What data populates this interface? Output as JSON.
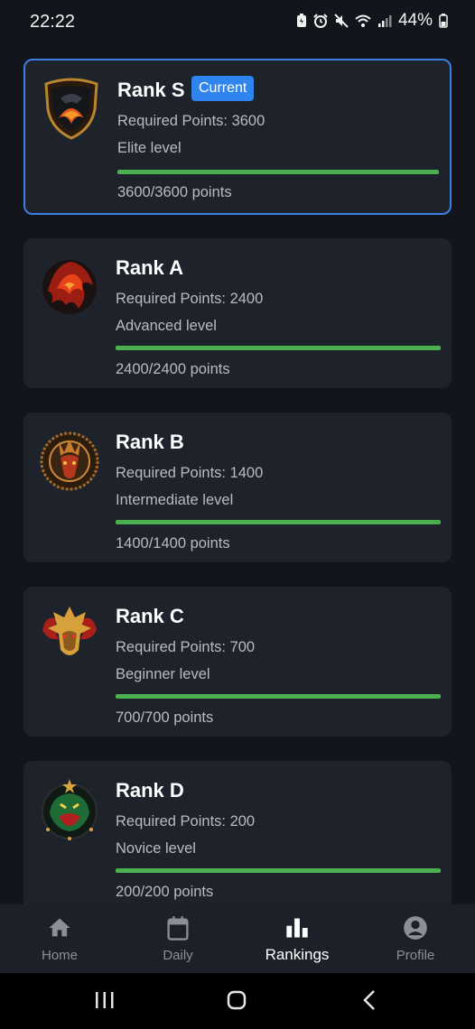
{
  "status": {
    "time": "22:22",
    "battery": "44%"
  },
  "colors": {
    "accent": "#2f84ee",
    "progress": "#4caf50",
    "card": "#1e222b",
    "background": "#12151c"
  },
  "ranks": [
    {
      "title": "Rank S",
      "badge_icon": "dragon-shield-badge",
      "current_label": "Current",
      "required": "Required Points: 3600",
      "level": "Elite level",
      "points": "3600/3600 points",
      "progress": 1.0
    },
    {
      "title": "Rank A",
      "badge_icon": "fire-dragon-badge",
      "required": "Required Points: 2400",
      "level": "Advanced level",
      "points": "2400/2400 points",
      "progress": 1.0
    },
    {
      "title": "Rank B",
      "badge_icon": "bronze-dragon-emblem",
      "required": "Required Points: 1400",
      "level": "Intermediate level",
      "points": "1400/1400 points",
      "progress": 1.0
    },
    {
      "title": "Rank C",
      "badge_icon": "golden-dragon-badge",
      "required": "Required Points: 700",
      "level": "Beginner level",
      "points": "700/700 points",
      "progress": 1.0
    },
    {
      "title": "Rank D",
      "badge_icon": "green-dragon-badge",
      "required": "Required Points: 200",
      "level": "Novice level",
      "points": "200/200 points",
      "progress": 1.0
    }
  ],
  "nav": [
    {
      "label": "Home",
      "icon": "home-icon"
    },
    {
      "label": "Daily",
      "icon": "calendar-icon"
    },
    {
      "label": "Rankings",
      "icon": "bar-chart-icon",
      "active": true
    },
    {
      "label": "Profile",
      "icon": "account-circle-icon"
    }
  ]
}
